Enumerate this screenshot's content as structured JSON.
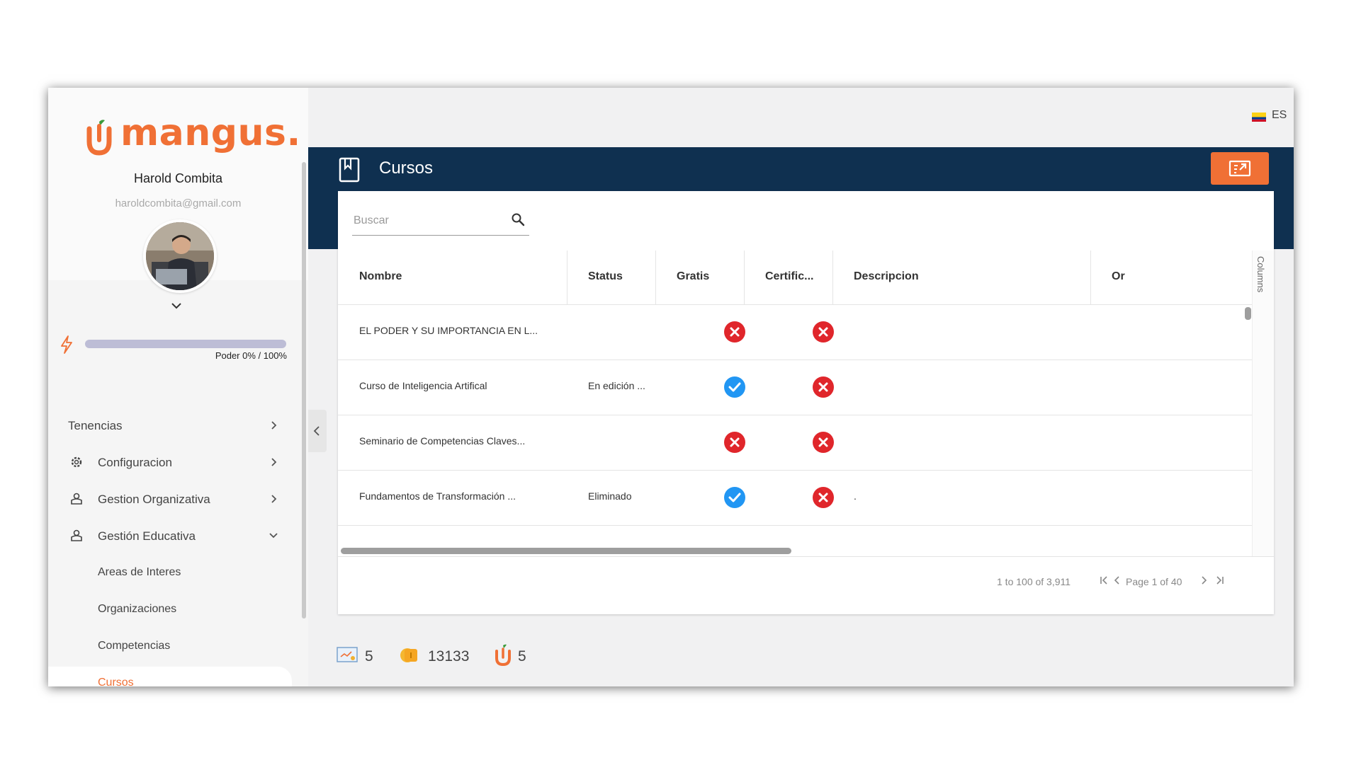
{
  "brand": {
    "name": "mangus.",
    "accent": "#f07035",
    "navy": "#0f3050"
  },
  "user": {
    "name": "Harold Combita",
    "email": "haroldcombita@gmail.com"
  },
  "power": {
    "label": "Poder 0% / 100%",
    "fraction": 0.0
  },
  "nav": {
    "items": [
      {
        "label": "Tenencias",
        "icon": "",
        "chevron": "chevron-right-icon"
      },
      {
        "label": "Configuracion",
        "icon": "gear-icon",
        "chevron": "chevron-right-icon"
      },
      {
        "label": "Gestion Organizativa",
        "icon": "users-icon",
        "chevron": "chevron-right-icon"
      },
      {
        "label": "Gestión Educativa",
        "icon": "users-icon",
        "chevron": "chevron-down-icon"
      }
    ],
    "subitems": [
      {
        "label": "Areas de Interes"
      },
      {
        "label": "Organizaciones"
      },
      {
        "label": "Competencias"
      },
      {
        "label": "Cursos",
        "active": true
      }
    ]
  },
  "topbar": {
    "language": "ES",
    "flag": "colombia-flag"
  },
  "page": {
    "title": "Cursos"
  },
  "search": {
    "placeholder": "Buscar"
  },
  "table": {
    "columns": [
      "Nombre",
      "Status",
      "Gratis",
      "Certific...",
      "Descripcion",
      "Or"
    ],
    "rows": [
      {
        "nombre": "EL PODER Y SU IMPORTANCIA EN L...",
        "status": "",
        "gratis": false,
        "certificado": false,
        "descripcion": ""
      },
      {
        "nombre": "Curso de Inteligencia Artifical",
        "status": "En edición ...",
        "gratis": true,
        "certificado": false,
        "descripcion": ""
      },
      {
        "nombre": "Seminario de Competencias Claves...",
        "status": "",
        "gratis": false,
        "certificado": false,
        "descripcion": ""
      },
      {
        "nombre": "Fundamentos de Transformación ...",
        "status": "Eliminado",
        "gratis": true,
        "certificado": false,
        "descripcion": "."
      }
    ],
    "side_panel_label": "Columns"
  },
  "pagination": {
    "range": "1 to 100 of 3,911",
    "page_text": "Page 1 of 40"
  },
  "footer": {
    "stats": [
      {
        "icon": "presentation-icon",
        "value": "5"
      },
      {
        "icon": "coins-icon",
        "value": "13133"
      },
      {
        "icon": "mangus-logo-icon",
        "value": "5"
      }
    ]
  },
  "colors": {
    "error": "#e0262b",
    "success": "#2196f3"
  }
}
